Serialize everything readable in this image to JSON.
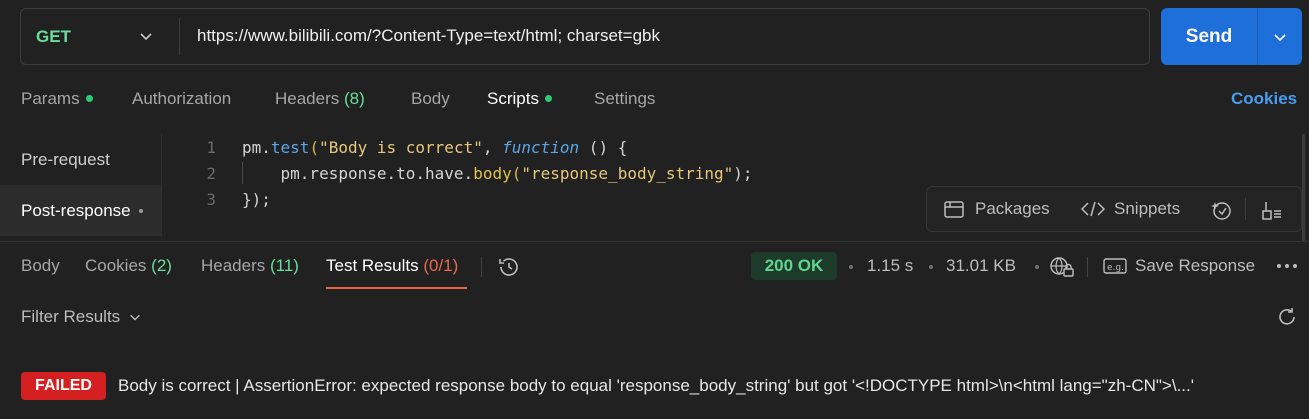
{
  "request": {
    "method": "GET",
    "url": "https://www.bilibili.com/?Content-Type=text/html; charset=gbk",
    "send_label": "Send"
  },
  "request_tabs": {
    "params": "Params",
    "authorization": "Authorization",
    "headers": "Headers",
    "headers_count": "(8)",
    "body": "Body",
    "scripts": "Scripts",
    "settings": "Settings",
    "cookies": "Cookies"
  },
  "scripts_nav": {
    "pre_request": "Pre-request",
    "post_response": "Post-response"
  },
  "editor": {
    "line_numbers": [
      "1",
      "2",
      "3"
    ],
    "line1": {
      "a": "pm.",
      "b": "test",
      "c": "(",
      "d": "\"Body is correct\"",
      "e": ", ",
      "f": "function",
      "g": " () {"
    },
    "line2": {
      "a": "    pm.response.to.have.",
      "b": "body",
      "c": "(",
      "d": "\"response_body_string\"",
      "e": ");"
    },
    "line3": "});"
  },
  "editor_tools": {
    "packages": "Packages",
    "snippets": "Snippets"
  },
  "response_tabs": {
    "body": "Body",
    "cookies": "Cookies",
    "cookies_count": "(2)",
    "headers": "Headers",
    "headers_count": "(11)",
    "test_results": "Test Results",
    "test_results_count": "(0/1)"
  },
  "response_meta": {
    "status": "200 OK",
    "time": "1.15 s",
    "size": "31.01 KB",
    "save_response": "Save Response"
  },
  "filter": {
    "label": "Filter Results"
  },
  "result": {
    "badge": "FAILED",
    "message": "Body is correct | AssertionError: expected response body to equal 'response_body_string' but got '<!DOCTYPE html>\\n<html lang=\"zh-CN\">\\...'"
  },
  "colors": {
    "accent_blue": "#1e6fd9",
    "method_green": "#6bdd9a",
    "failed_red": "#d42020",
    "status_green": "#5fd68f",
    "active_underline": "#e8673e"
  }
}
